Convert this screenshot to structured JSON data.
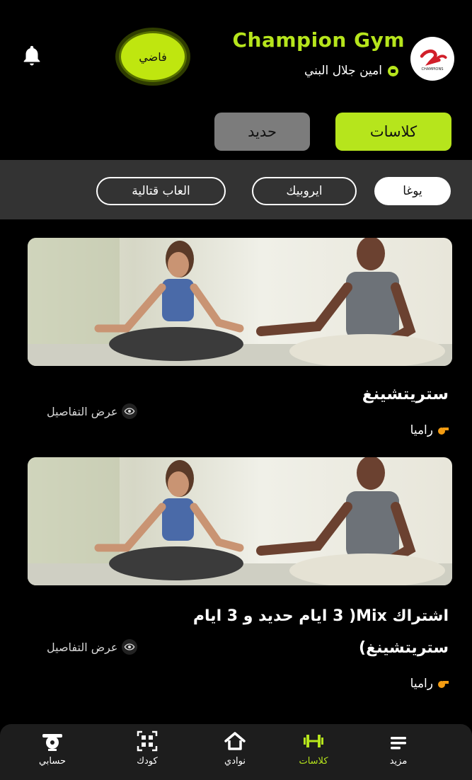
{
  "header": {
    "brand_title": "Champion Gym",
    "user_name": "امين جلال البني",
    "status_badge": "فاضي",
    "logo_text": "CHAMPIONS"
  },
  "segments": [
    {
      "label": "كلاسات",
      "active": true
    },
    {
      "label": "حديد",
      "active": false
    }
  ],
  "filters": [
    {
      "label": "يوغا",
      "active": true
    },
    {
      "label": "ايروبيك",
      "active": false
    },
    {
      "label": "العاب قتالية",
      "active": false
    }
  ],
  "cards": [
    {
      "title": "ستريتشينغ",
      "details_label": "عرض التفاصيل",
      "trainer": "راميا"
    },
    {
      "title": "اشتراك Mix( 3 ايام حديد و 3 ايام ستريتشينغ)",
      "details_label": "عرض التفاصيل",
      "trainer": "راميا"
    }
  ],
  "bottom_nav": [
    {
      "label": "حسابي",
      "icon": "barbell-plate-icon",
      "active": false
    },
    {
      "label": "كودك",
      "icon": "qr-code-icon",
      "active": false
    },
    {
      "label": "نوادي",
      "icon": "home-icon",
      "active": false
    },
    {
      "label": "كلاسات",
      "icon": "dumbbell-icon",
      "active": true
    },
    {
      "label": "مزيد",
      "icon": "menu-icon",
      "active": false
    }
  ],
  "colors": {
    "accent": "#b6e51c",
    "background": "#000000",
    "inactive_segment": "#7c7c7c",
    "filter_bar": "#333333"
  }
}
